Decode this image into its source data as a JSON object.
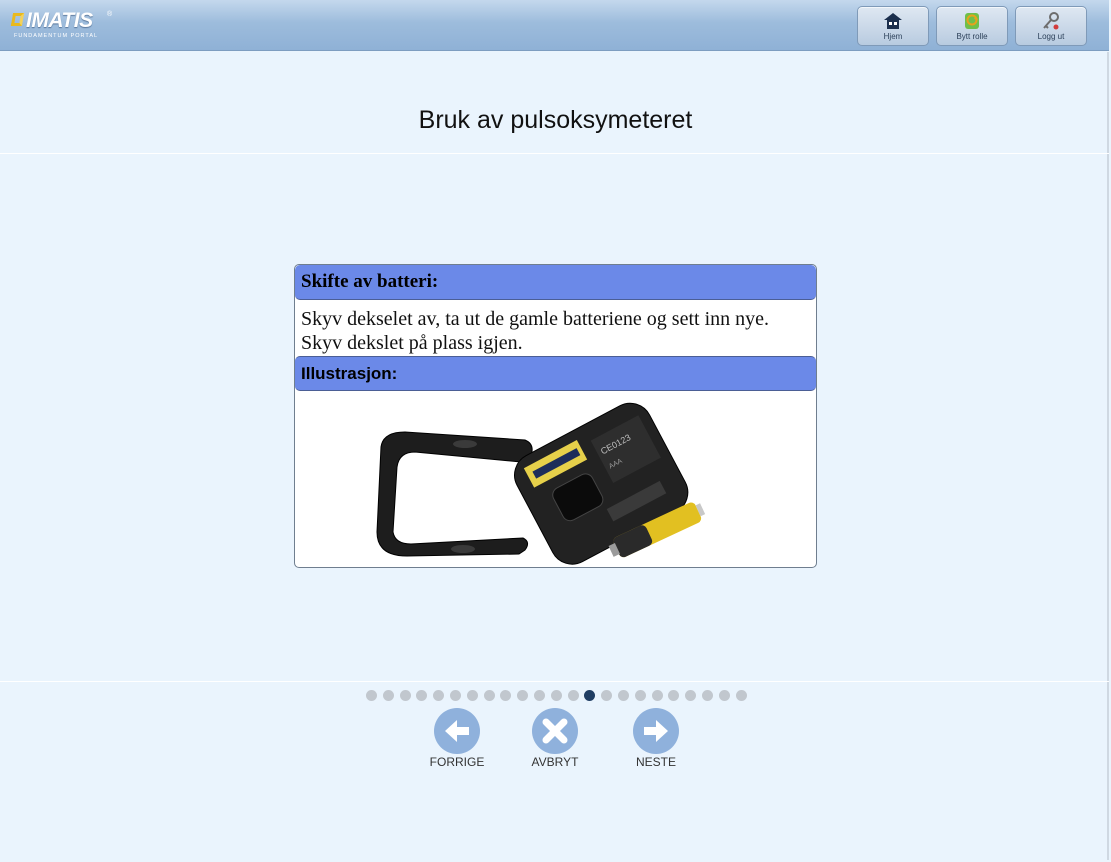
{
  "header": {
    "logo_name": "IMATIS",
    "logo_registered": "®",
    "logo_tagline": "FUNDAMENTUM PORTAL",
    "buttons": [
      {
        "label": "Hjem",
        "icon": "home-icon"
      },
      {
        "label": "Bytt rolle",
        "icon": "switch-role-icon"
      },
      {
        "label": "Logg ut",
        "icon": "logout-key-icon"
      }
    ]
  },
  "page": {
    "title": "Bruk av pulsoksymeteret"
  },
  "card": {
    "heading": "Skifte av batteri:",
    "text_line_1": "Skyv dekselet av, ta ut de gamle batteriene og sett inn nye.",
    "text_line_2": "Skyv dekslet på plass igjen.",
    "illustration_heading": "Illustrasjon:",
    "illustration_alt": "pulse-oximeter-battery-photo"
  },
  "progress": {
    "total_steps": 23,
    "current_step": 14
  },
  "nav": {
    "prev_label": "FORRIGE",
    "cancel_label": "AVBRYT",
    "next_label": "NESTE"
  },
  "colors": {
    "accent": "#6b89e8",
    "nav_button": "#8fb1dc",
    "active_dot": "#1f3d63",
    "inactive_dot": "#c1c7ce",
    "background": "#eaf4fd"
  }
}
